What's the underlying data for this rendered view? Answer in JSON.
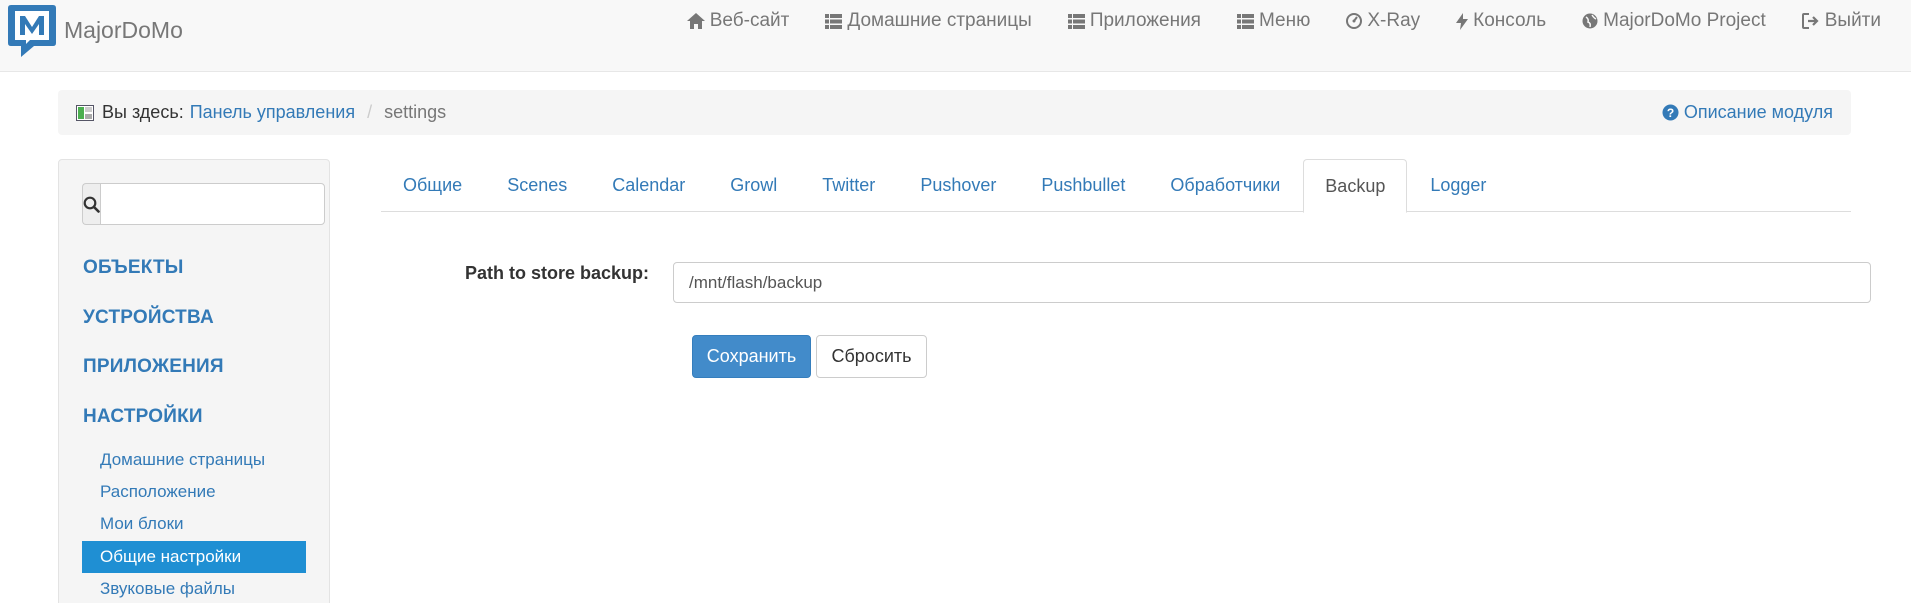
{
  "brand": {
    "name": "MajorDoMo",
    "logo_letter": "M",
    "color": "#337ab7"
  },
  "navbar": {
    "items": [
      {
        "label": "Веб-сайт",
        "icon": "home-icon"
      },
      {
        "label": "Домашние страницы",
        "icon": "list-icon"
      },
      {
        "label": "Приложения",
        "icon": "list-icon"
      },
      {
        "label": "Меню",
        "icon": "list-icon"
      },
      {
        "label": "X-Ray",
        "icon": "dashboard-icon"
      },
      {
        "label": "Консоль",
        "icon": "flash-icon"
      },
      {
        "label": "MajorDoMo Project",
        "icon": "globe-icon"
      },
      {
        "label": "Выйти",
        "icon": "logout-icon"
      }
    ]
  },
  "breadcrumb": {
    "prefix": "Вы здесь:",
    "link": "Панель управления",
    "current": "settings",
    "help": "Описание модуля"
  },
  "sidebar": {
    "search": {
      "value": "",
      "placeholder": ""
    },
    "sections": [
      {
        "label": "ОБЪЕКТЫ"
      },
      {
        "label": "УСТРОЙСТВА"
      },
      {
        "label": "ПРИЛОЖЕНИЯ"
      },
      {
        "label": "НАСТРОЙКИ"
      }
    ],
    "settings_items": [
      {
        "label": "Домашние страницы",
        "active": false
      },
      {
        "label": "Расположение",
        "active": false
      },
      {
        "label": "Мои блоки",
        "active": false
      },
      {
        "label": "Общие настройки",
        "active": true
      },
      {
        "label": "Звуковые файлы",
        "active": false
      }
    ]
  },
  "tabs": [
    {
      "label": "Общие",
      "active": false
    },
    {
      "label": "Scenes",
      "active": false
    },
    {
      "label": "Calendar",
      "active": false
    },
    {
      "label": "Growl",
      "active": false
    },
    {
      "label": "Twitter",
      "active": false
    },
    {
      "label": "Pushover",
      "active": false
    },
    {
      "label": "Pushbullet",
      "active": false
    },
    {
      "label": "Обработчики",
      "active": false
    },
    {
      "label": "Backup",
      "active": true
    },
    {
      "label": "Logger",
      "active": false
    }
  ],
  "form": {
    "path_label": "Path to store backup:",
    "path_value": "/mnt/flash/backup",
    "save_label": "Сохранить",
    "reset_label": "Сбросить"
  },
  "colors": {
    "link": "#337ab7",
    "primary": "#428bca",
    "active_item": "#1f8fd3"
  }
}
